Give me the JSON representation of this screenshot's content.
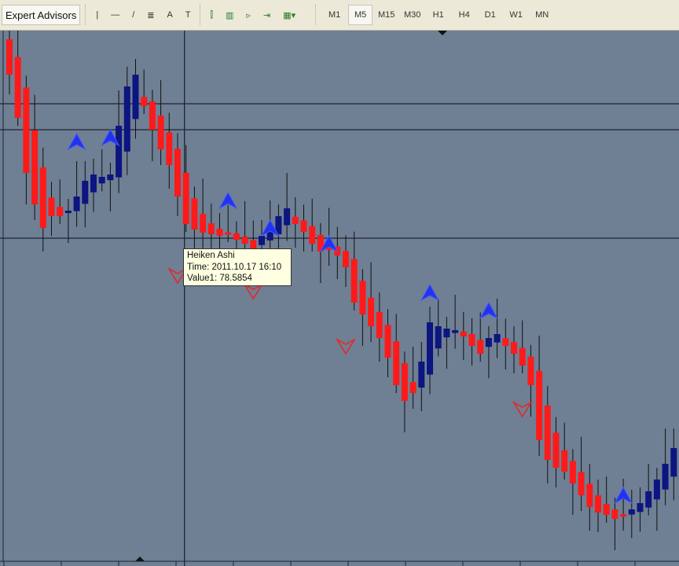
{
  "toolbar": {
    "expert_advisors": "Expert Advisors",
    "tools": [
      {
        "icon": "vertical-line-icon",
        "g": "|"
      },
      {
        "icon": "horizontal-line-icon",
        "g": "—"
      },
      {
        "icon": "trendline-icon",
        "g": "/"
      },
      {
        "icon": "fibonacci-icon",
        "g": "≣"
      },
      {
        "icon": "text-icon",
        "g": "A"
      },
      {
        "icon": "text-label-icon",
        "g": "T"
      }
    ],
    "chart_tools": [
      {
        "icon": "bar-chart-icon",
        "g": "⫿"
      },
      {
        "icon": "candlestick-icon",
        "g": "▥"
      },
      {
        "icon": "auto-scroll-icon",
        "g": "▹"
      },
      {
        "icon": "chart-shift-icon",
        "g": "⇥"
      },
      {
        "icon": "templates-icon",
        "g": "▦▾"
      }
    ],
    "timeframes": [
      "M1",
      "M5",
      "M15",
      "M30",
      "H1",
      "H4",
      "D1",
      "W1",
      "MN"
    ],
    "active_timeframe": "M5"
  },
  "tooltip": {
    "title": "Heiken Ashi",
    "time": "Time: 2011.10.17 16:10",
    "value": "Value1: 78.5854"
  },
  "chart_data": {
    "type": "candlestick",
    "indicator": "Heiken Ashi",
    "ylim": [
      77.8,
      79.2
    ],
    "colors": {
      "bull": "#0c1580",
      "bear": "#ff1a1a",
      "background": "#6f7f94",
      "grid": "#1d2430",
      "up_arrow": "#2233ee",
      "down_arrow": "#ee2222"
    },
    "first_open": 79.085,
    "closes": [
      78.995,
      78.885,
      78.745,
      78.665,
      78.605,
      78.635,
      78.635,
      78.649,
      78.685,
      78.725,
      78.741,
      78.735,
      78.741,
      78.865,
      78.965,
      78.995,
      78.915,
      78.855,
      78.805,
      78.765,
      78.685,
      78.615,
      78.601,
      78.593,
      78.589,
      78.585,
      78.589,
      78.575,
      78.565,
      78.549,
      78.585,
      78.605,
      78.635,
      78.655,
      78.615,
      78.595,
      78.565,
      78.545,
      78.549,
      78.535,
      78.505,
      78.415,
      78.385,
      78.355,
      78.325,
      78.275,
      78.205,
      78.165,
      78.185,
      78.265,
      78.365,
      78.355,
      78.349,
      78.345,
      78.329,
      78.305,
      78.285,
      78.325,
      78.335,
      78.305,
      78.285,
      78.255,
      78.205,
      78.065,
      78.015,
      77.995,
      77.985,
      77.955,
      77.925,
      77.895,
      77.881,
      77.875,
      77.865,
      77.875,
      77.889,
      77.905,
      77.935,
      77.965,
      78.005,
      78.045
    ],
    "up_arrows": [
      {
        "i": 8,
        "price": 78.825
      },
      {
        "i": 12,
        "price": 78.835
      },
      {
        "i": 26,
        "price": 78.675
      },
      {
        "i": 31,
        "price": 78.605
      },
      {
        "i": 38,
        "price": 78.565
      },
      {
        "i": 50,
        "price": 78.441
      },
      {
        "i": 57,
        "price": 78.395
      },
      {
        "i": 73,
        "price": 77.925
      }
    ],
    "down_arrows": [
      {
        "i": 20,
        "price": 78.485
      },
      {
        "i": 29,
        "price": 78.445
      },
      {
        "i": 40,
        "price": 78.305
      },
      {
        "i": 61,
        "price": 78.145
      }
    ],
    "hlines": [
      78.921,
      78.855,
      78.579
    ],
    "crosshair_index": 21
  }
}
